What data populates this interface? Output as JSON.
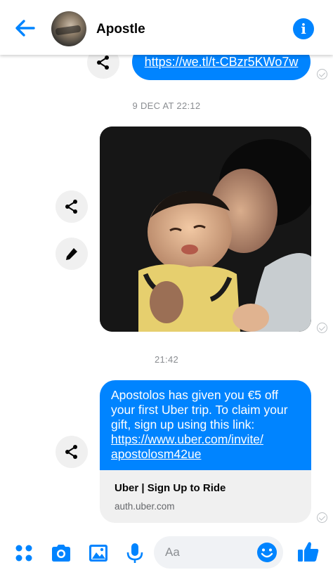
{
  "header": {
    "contact_name": "Apostle",
    "info_glyph": "i"
  },
  "messages": {
    "link_message": "https://we.tl/t-CBzr5KWo7w",
    "timestamp_1": "9 DEC AT 22:12",
    "timestamp_2": "21:42",
    "uber_message": {
      "line_1": "Apostolos has given you €5 off",
      "line_2": "your first Uber trip. To claim your",
      "line_3": "gift, sign up using this link:",
      "link_line_1": "https://www.uber.com/invite/",
      "link_line_2": "apostolosm42ue"
    },
    "link_preview": {
      "title": "Uber | Sign Up to Ride",
      "domain": "auth.uber.com"
    }
  },
  "composer": {
    "placeholder": "Aa"
  },
  "icons": {
    "back": "back-arrow-icon",
    "info": "info-icon",
    "share": "share-icon",
    "edit": "pencil-icon",
    "seen": "seen-check-icon",
    "menu": "four-dots-icon",
    "camera": "camera-icon",
    "gallery": "image-icon",
    "mic": "microphone-icon",
    "emoji": "smiley-icon",
    "like": "thumbs-up-icon"
  },
  "colors": {
    "accent": "#0084ff",
    "bubble_text": "#ffffff",
    "muted": "#8a8d91",
    "button_bg": "#f0f0f0"
  }
}
